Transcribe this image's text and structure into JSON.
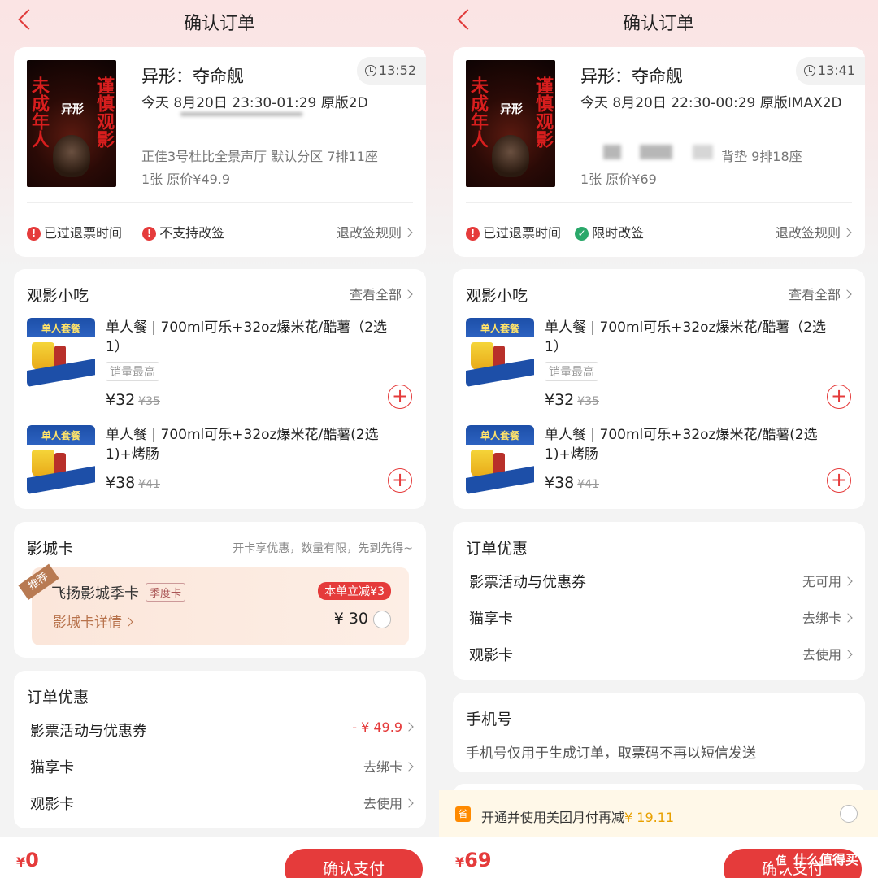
{
  "left": {
    "header": {
      "title": "确认订单"
    },
    "movie": {
      "title": "异形：夺命舰",
      "time_left": "13:52",
      "schedule": "今天 8月20日 23:30-01:29 原版2D",
      "seat": "正佳3号杜比全景声厅 默认分区 7排11座",
      "price": "1张 原价¥49.9",
      "poster": {
        "left": "未成年人",
        "right": "谨慎观影",
        "center": "异形"
      }
    },
    "notes": {
      "refund": "已过退票时间",
      "change": "不支持改签",
      "rules": "退改签规则"
    },
    "snacks": {
      "title": "观影小吃",
      "more": "查看全部",
      "items": [
        {
          "name": "单人餐 | 700ml可乐+32oz爆米花/酷薯（2选1）",
          "tag": "销量最高",
          "price": "¥32",
          "orig": "¥35"
        },
        {
          "name": "单人餐 | 700ml可乐+32oz爆米花/酷薯(2选1)+烤肠",
          "price": "¥38",
          "orig": "¥41"
        }
      ]
    },
    "cinema_card": {
      "title": "影城卡",
      "hint": "开卡享优惠，数量有限，先到先得~",
      "recommend": "推荐",
      "name": "飞扬影城季卡",
      "tag": "季度卡",
      "detail": "影城卡详情",
      "badge": "本单立减¥3",
      "price": "¥ 30"
    },
    "discount": {
      "title": "订单优惠",
      "rows": [
        {
          "label": "影票活动与优惠券",
          "value": "- ¥ 49.9"
        },
        {
          "label": "猫享卡",
          "value": "去绑卡"
        },
        {
          "label": "观影卡",
          "value": "去使用"
        }
      ]
    },
    "footer": {
      "currency": "¥",
      "amount": "0",
      "pay": "确认支付"
    }
  },
  "right": {
    "header": {
      "title": "确认订单"
    },
    "movie": {
      "title": "异形：夺命舰",
      "time_left": "13:41",
      "schedule": "今天 8月20日 22:30-00:29 原版IMAX2D",
      "seat": "背垫 9排18座",
      "price": "1张 原价¥69"
    },
    "notes": {
      "refund": "已过退票时间",
      "change": "限时改签",
      "rules": "退改签规则"
    },
    "snacks": {
      "title": "观影小吃",
      "more": "查看全部",
      "items": [
        {
          "name": "单人餐 | 700ml可乐+32oz爆米花/酷薯（2选1）",
          "tag": "销量最高",
          "price": "¥32",
          "orig": "¥35"
        },
        {
          "name": "单人餐 | 700ml可乐+32oz爆米花/酷薯(2选1)+烤肠",
          "price": "¥38",
          "orig": "¥41"
        }
      ]
    },
    "discount": {
      "title": "订单优惠",
      "rows": [
        {
          "label": "影票活动与优惠券",
          "value": "无可用"
        },
        {
          "label": "猫享卡",
          "value": "去绑卡"
        },
        {
          "label": "观影卡",
          "value": "去使用"
        }
      ]
    },
    "phone": {
      "title": "手机号",
      "note": "手机号仅用于生成订单，取票码不再以短信发送"
    },
    "promo": {
      "icon": "省",
      "text": "开通并使用美团月付再减",
      "amount": "¥ 19.11"
    },
    "footer": {
      "currency": "¥",
      "amount": "69",
      "pay": "确认支付"
    }
  },
  "snack_image_text": "单人套餐",
  "watermark": {
    "icon": "值",
    "text": "什么值得买"
  },
  "colors": {
    "accent": "#e53b3b",
    "card_gold": "#b8734c",
    "promo": "#e8a000"
  }
}
